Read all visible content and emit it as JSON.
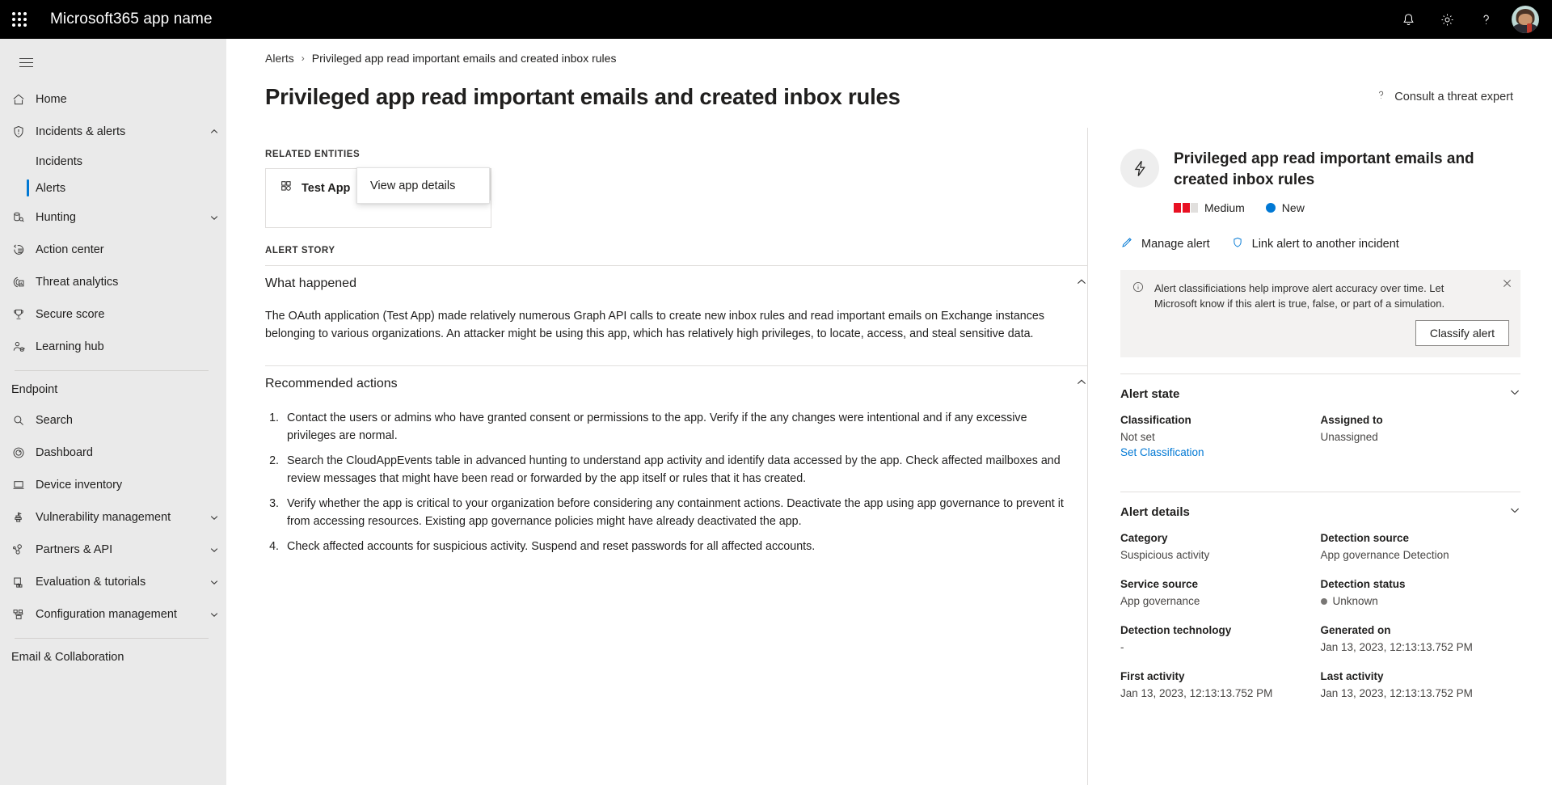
{
  "topbar": {
    "title": "Microsoft365 app name",
    "waffle_icon": "app-launcher-icon",
    "notifications_icon": "bell-icon",
    "settings_icon": "gear-icon",
    "help_icon": "help-icon",
    "avatar_icon": "user-avatar"
  },
  "sidebar": {
    "menu_icon": "hamburger-icon",
    "items": [
      {
        "label": "Home",
        "icon": "home-icon",
        "chevron": ""
      },
      {
        "label": "Incidents & alerts",
        "icon": "shield-alert-icon",
        "chevron": "up"
      },
      {
        "label": "Hunting",
        "icon": "hunting-icon",
        "chevron": "down"
      },
      {
        "label": "Action center",
        "icon": "action-center-icon",
        "chevron": ""
      },
      {
        "label": "Threat analytics",
        "icon": "threat-analytics-icon",
        "chevron": ""
      },
      {
        "label": "Secure score",
        "icon": "trophy-icon",
        "chevron": ""
      },
      {
        "label": "Learning hub",
        "icon": "learning-hub-icon",
        "chevron": ""
      }
    ],
    "sub_items": [
      {
        "label": "Incidents",
        "selected": false
      },
      {
        "label": "Alerts",
        "selected": true
      }
    ],
    "endpoint_section": "Endpoint",
    "endpoint_items": [
      {
        "label": "Search",
        "icon": "search-icon",
        "chevron": ""
      },
      {
        "label": "Dashboard",
        "icon": "dashboard-icon",
        "chevron": ""
      },
      {
        "label": "Device inventory",
        "icon": "device-icon",
        "chevron": ""
      },
      {
        "label": "Vulnerability management",
        "icon": "vulnerability-icon",
        "chevron": "down"
      },
      {
        "label": "Partners & API",
        "icon": "partners-icon",
        "chevron": "down"
      },
      {
        "label": "Evaluation & tutorials",
        "icon": "evaluation-icon",
        "chevron": "down"
      },
      {
        "label": "Configuration management",
        "icon": "configuration-icon",
        "chevron": "down"
      }
    ],
    "email_section": "Email & Collaboration"
  },
  "breadcrumb": {
    "parent": "Alerts",
    "separator": "›",
    "current": "Privileged app read important emails and created inbox rules"
  },
  "page": {
    "title": "Privileged app read important emails and created inbox rules",
    "consult_label": "Consult a threat expert",
    "consult_icon": "help-icon"
  },
  "related_entities": {
    "caption": "RELATED ENTITIES",
    "entity_name": "Test App",
    "entity_icon": "app-entity-icon",
    "more_label": "···",
    "menu_item": "View app details"
  },
  "alert_story": {
    "caption": "ALERT STORY",
    "what_happened_title": "What happened",
    "what_happened_body": "The OAuth application (Test App) made relatively numerous Graph API calls to create new inbox rules and read important emails on Exchange instances belonging to various organizations. An attacker might be using this app, which has relatively high privileges, to locate, access, and steal sensitive data.",
    "recommended_title": "Recommended actions",
    "recommended_actions": [
      "Contact the users or admins who have granted consent or permissions to the app. Verify if the any changes were intentional and if any excessive privileges are normal.",
      "Search the CloudAppEvents table in advanced hunting to understand app activity and identify data accessed by the app. Check affected mailboxes and review messages that might have been read or forwarded by the app itself or rules that it has created.",
      "Verify whether the app is critical to your organization before considering any containment actions. Deactivate the app using app governance to prevent it from accessing resources. Existing app governance policies might have already deactivated the app.",
      "Check affected accounts for suspicious activity. Suspend and reset passwords for all affected accounts."
    ]
  },
  "right_panel": {
    "icon": "lightning-bolt-icon",
    "title": "Privileged app read important emails and created inbox rules",
    "severity_label": "Medium",
    "severity_color": "#e81123",
    "severity_filled": 2,
    "severity_total": 3,
    "status_label": "New",
    "status_color": "#0078d4",
    "actions": [
      {
        "label": "Manage alert",
        "icon": "pencil-icon"
      },
      {
        "label": "Link alert to another incident",
        "icon": "shield-icon"
      }
    ],
    "notice": {
      "icon": "info-icon",
      "text": "Alert classificiations help improve alert accuracy over time. Let Microsoft know if this alert is true, false, or part of a simulation.",
      "close_icon": "close-icon",
      "button_label": "Classify alert"
    },
    "alert_state": {
      "title": "Alert state",
      "chevron": "down",
      "fields": [
        {
          "label": "Classification",
          "value": "Not set",
          "link": "Set Classification"
        },
        {
          "label": "Assigned to",
          "value": "Unassigned",
          "link": ""
        }
      ]
    },
    "alert_details": {
      "title": "Alert details",
      "chevron": "down",
      "fields": [
        {
          "label": "Category",
          "value": "Suspicious activity",
          "dot": false
        },
        {
          "label": "Detection source",
          "value": "App governance Detection",
          "dot": false
        },
        {
          "label": "Service source",
          "value": "App governance",
          "dot": false
        },
        {
          "label": "Detection status",
          "value": "Unknown",
          "dot": true
        },
        {
          "label": "Detection technology",
          "value": "-",
          "dot": false
        },
        {
          "label": "Generated on",
          "value": "Jan 13, 2023, 12:13:13.752 PM",
          "dot": false
        },
        {
          "label": "First activity",
          "value": "Jan 13, 2023, 12:13:13.752 PM",
          "dot": false
        },
        {
          "label": "Last activity",
          "value": "Jan 13, 2023, 12:13:13.752 PM",
          "dot": false
        }
      ]
    }
  }
}
